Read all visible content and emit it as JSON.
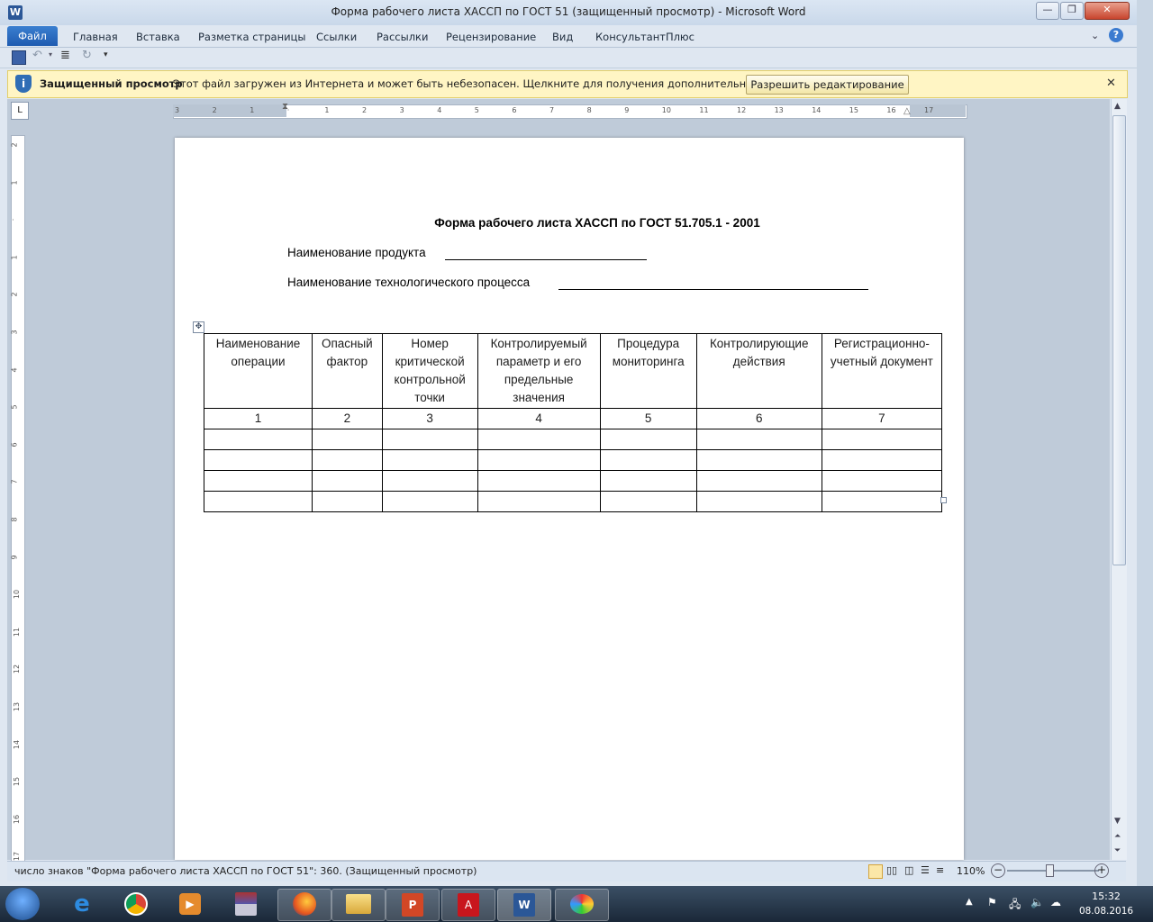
{
  "window": {
    "title": "Форма рабочего листа ХАССП по ГОСТ 51 (защищенный просмотр)  -  Microsoft Word",
    "app_icon_letter": "W"
  },
  "ribbon": {
    "tabs": [
      "Файл",
      "Главная",
      "Вставка",
      "Разметка страницы",
      "Ссылки",
      "Рассылки",
      "Рецензирование",
      "Вид",
      "КонсультантПлюс"
    ]
  },
  "qat": {
    "icons": [
      "save-icon",
      "undo-icon",
      "paragraph-icon",
      "redo-icon",
      "customize-icon"
    ]
  },
  "protected_view": {
    "label": "Защищенный просмотр",
    "message": "Этот файл загружен из Интернета и может быть небезопасен. Щелкните для получения дополнительных сведений.",
    "button": "Разрешить редактирование",
    "close": "✕"
  },
  "ruler": {
    "h_labels": [
      "3",
      "2",
      "1",
      "",
      "1",
      "2",
      "3",
      "4",
      "5",
      "6",
      "7",
      "8",
      "9",
      "10",
      "11",
      "12",
      "13",
      "14",
      "15",
      "16",
      "17"
    ],
    "v_labels": [
      "2",
      "1",
      "",
      "1",
      "2",
      "3",
      "4",
      "5",
      "6",
      "7",
      "8",
      "9",
      "10",
      "11",
      "12",
      "13",
      "14",
      "15",
      "16",
      "17"
    ],
    "corner": "L"
  },
  "document": {
    "title": "Форма рабочего листа ХАССП по ГОСТ 51.705.1 - 2001",
    "product_label": "Наименование продукта",
    "process_label": "Наименование технологического процесса",
    "table": {
      "headers": [
        "Наименование операции",
        "Опасный фактор",
        "Номер критической контрольной точки",
        "Контролируемый параметр и его предельные значения",
        "Процедура мониторинга",
        "Контролирующие действия",
        "Регистрационно-учетный документ"
      ],
      "numbers": [
        "1",
        "2",
        "3",
        "4",
        "5",
        "6",
        "7"
      ],
      "empty_rows": 4
    }
  },
  "status_bar": {
    "text": "число знаков \"Форма рабочего листа ХАССП по ГОСТ 51\": 360. (Защищенный просмотр)",
    "zoom": "110%"
  },
  "taskbar": {
    "apps": [
      "start-button",
      "internet-explorer-icon",
      "chrome-icon",
      "media-player-icon",
      "winrar-icon",
      "firefox-icon",
      "explorer-icon",
      "powerpoint-icon",
      "acrobat-icon",
      "word-icon",
      "paint-icon"
    ],
    "time": "15:32",
    "date": "08.08.2016"
  },
  "colors": {
    "file_tab": "#1f5bb0",
    "message_bar": "#fff5c4",
    "workspace": "#bfcbd9"
  }
}
